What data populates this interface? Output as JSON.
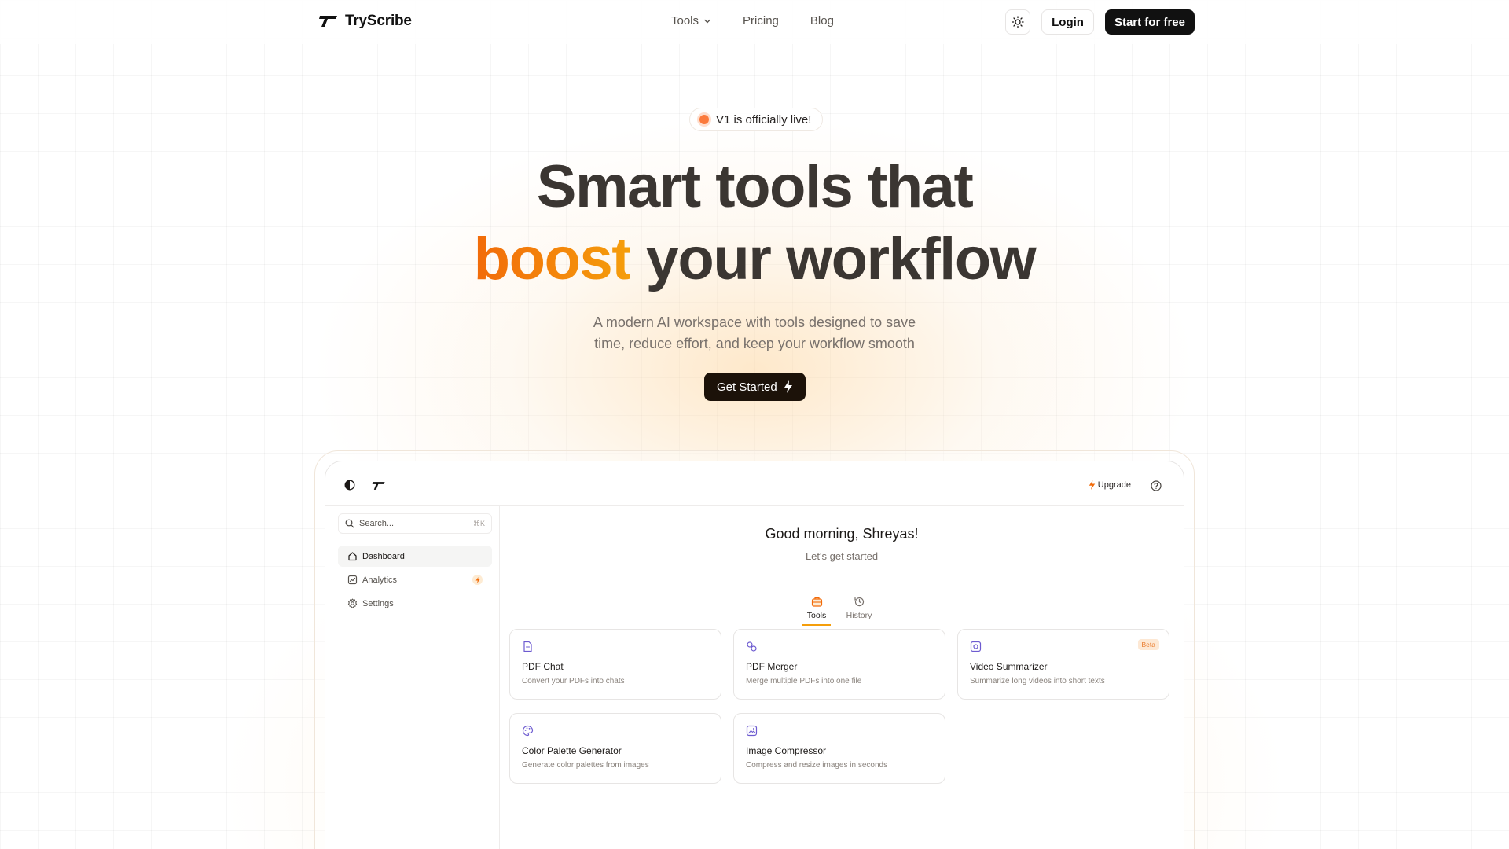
{
  "nav": {
    "brand": "TryScribe",
    "links": [
      {
        "label": "Tools",
        "has_dropdown": true
      },
      {
        "label": "Pricing"
      },
      {
        "label": "Blog"
      }
    ],
    "theme_icon": "sun-icon",
    "login_label": "Login",
    "start_label": "Start for free"
  },
  "hero": {
    "badge": "V1 is officially live!",
    "title_line1": "Smart tools that",
    "title_accent": "boost",
    "title_line2_rest": " your workflow",
    "subtitle_line1": "A modern AI workspace with tools designed to save",
    "subtitle_line2": "time, reduce effort, and keep your workflow smooth",
    "cta_label": "Get Started"
  },
  "app": {
    "upgrade_label": "Upgrade",
    "search_placeholder": "Search...",
    "search_shortcut": "⌘K",
    "sidebar": [
      {
        "label": "Dashboard",
        "icon": "home-icon",
        "active": true
      },
      {
        "label": "Analytics",
        "icon": "chart-icon",
        "pro": true
      },
      {
        "label": "Settings",
        "icon": "gear-icon"
      }
    ],
    "greeting": "Good morning, Shreyas!",
    "greeting_sub": "Let's get started",
    "tabs": [
      {
        "label": "Tools",
        "icon": "briefcase-icon",
        "active": true
      },
      {
        "label": "History",
        "icon": "history-icon"
      }
    ],
    "tools": [
      {
        "title": "PDF Chat",
        "desc": "Convert your PDFs into chats",
        "icon": "pdf-chat-icon"
      },
      {
        "title": "PDF Merger",
        "desc": "Merge multiple PDFs into one file",
        "icon": "pdf-merge-icon"
      },
      {
        "title": "Video Summarizer",
        "desc": "Summarize long videos into short texts",
        "icon": "video-icon",
        "badge": "Beta"
      },
      {
        "title": "Color Palette Generator",
        "desc": "Generate color palettes from images",
        "icon": "palette-icon"
      },
      {
        "title": "Image Compressor",
        "desc": "Compress and resize images in seconds",
        "icon": "image-icon"
      }
    ]
  },
  "colors": {
    "accent_start": "#f26b0a",
    "accent_end": "#f59e0b",
    "dark": "#111111",
    "icon_purple": "#6d5bd0"
  }
}
